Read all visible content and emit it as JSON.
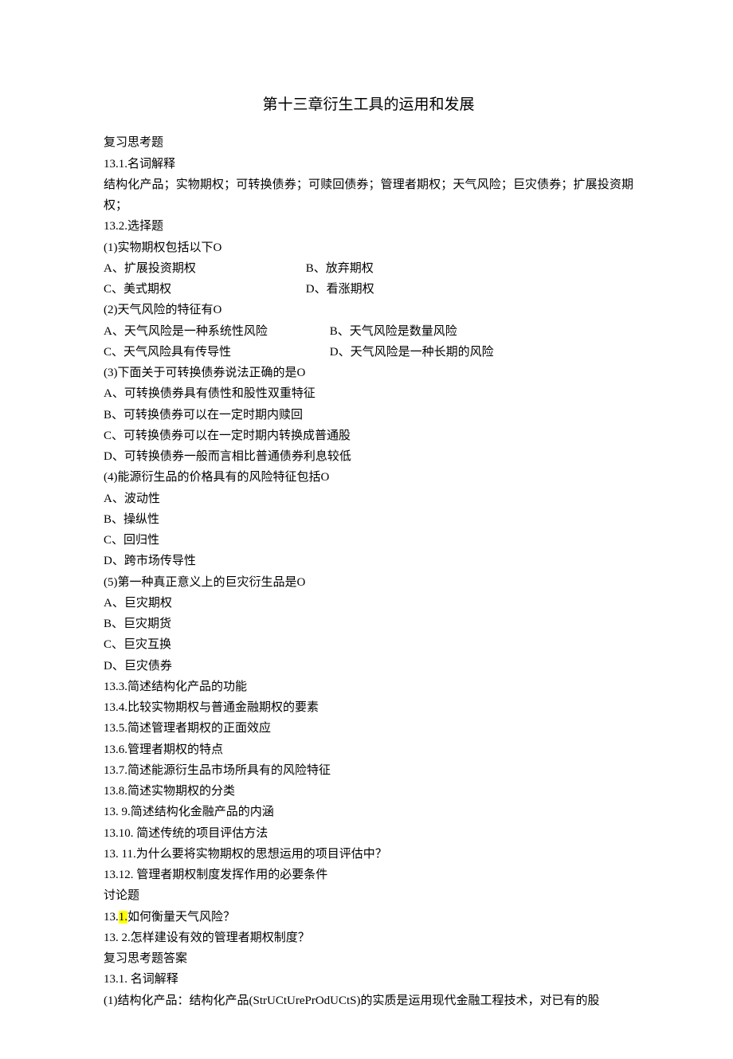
{
  "title": "第十三章衍生工具的运用和发展",
  "heading_review": "复习思考题",
  "sec_13_1_head": "13.1.名词解释",
  "sec_13_1_body": "结构化产品；实物期权；可转换债券；可赎回债券；管理者期权；天气风险；巨灾债券；扩展投资期权；",
  "sec_13_2_head": "13.2.选择题",
  "q1_stem": "(1)实物期权包括以下O",
  "q1_a": "A、扩展投资期权",
  "q1_b": "B、放弃期权",
  "q1_c": "C、美式期权",
  "q1_d": "D、看涨期权",
  "q2_stem": "(2)天气风险的特征有O",
  "q2_a": "A、天气风险是一种系统性风险",
  "q2_b": "B、天气风险是数量风险",
  "q2_c": "C、天气风险具有传导性",
  "q2_d": "D、天气风险是一种长期的风险",
  "q3_stem": "(3)下面关于可转换债券说法正确的是O",
  "q3_a": "A、可转换债券具有债性和股性双重特征",
  "q3_b": "B、可转换债券可以在一定时期内赎回",
  "q3_c": "C、可转换债券可以在一定时期内转换成普通股",
  "q3_d": "D、可转换债券一般而言相比普通债券利息较低",
  "q4_stem": "(4)能源衍生品的价格具有的风险特征包括O",
  "q4_a": "A、波动性",
  "q4_b": "B、操纵性",
  "q4_c": "C、回归性",
  "q4_d": "D、跨市场传导性",
  "q5_stem": "(5)第一种真正意义上的巨灾衍生品是O",
  "q5_a": "A、巨灾期权",
  "q5_b": "B、巨灾期货",
  "q5_c": "C、巨灾互换",
  "q5_d": "D、巨灾债券",
  "sec_13_3": "13.3.简述结构化产品的功能",
  "sec_13_4": "13.4.比较实物期权与普通金融期权的要素",
  "sec_13_5": "13.5.简述管理者期权的正面效应",
  "sec_13_6": "13.6.管理者期权的特点",
  "sec_13_7": "13.7.简述能源衍生品市场所具有的风险特征",
  "sec_13_8": "13.8.简述实物期权的分类",
  "sec_13_9": "13. 9.简述结构化金融产品的内涵",
  "sec_13_10": "13.10.  简述传统的项目评估方法",
  "sec_13_11": "13. 11.为什么要将实物期权的思想运用的项目评估中？",
  "sec_13_12": "13.12.  管理者期权制度发挥作用的必要条件",
  "heading_discuss": "讨论题",
  "disc_1_prefix": "13.",
  "disc_1_hl": "1.",
  "disc_1_rest": "如何衡量天气风险？",
  "disc_2": "13. 2.怎样建设有效的管理者期权制度？",
  "heading_answers": "复习思考题答案",
  "ans_13_1_head": "13.1.  名词解释",
  "ans_1": "(1)结构化产品：结构化产品(StrUCtUrePrOdUCtS)的实质是运用现代金融工程技术，对已有的股"
}
